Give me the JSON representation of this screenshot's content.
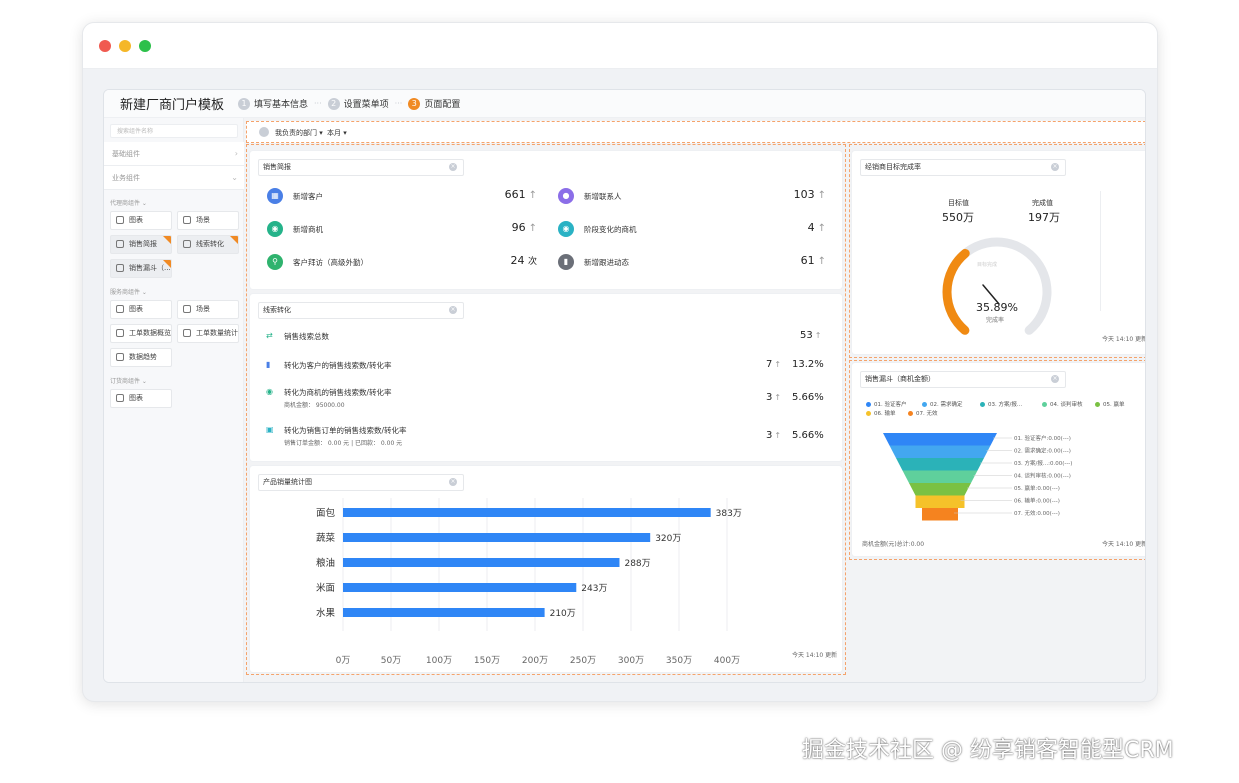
{
  "window": {
    "title_buttons": [
      {
        "name": "close",
        "color": "#f05a50"
      },
      {
        "name": "minimize",
        "color": "#f5b728"
      },
      {
        "name": "maximize",
        "color": "#2cc04a"
      }
    ]
  },
  "header": {
    "title": "新建厂商门户模板",
    "steps": [
      {
        "num": "1",
        "label": "填写基本信息"
      },
      {
        "num": "2",
        "label": "设置菜单项"
      },
      {
        "num": "3",
        "label": "页面配置"
      }
    ],
    "step_sep": "···"
  },
  "sidebar": {
    "search_placeholder": "搜索组件名称",
    "groups": [
      {
        "label": "基础组件",
        "chevron": "›"
      },
      {
        "label": "业务组件",
        "chevron": "⌄"
      }
    ],
    "sections": [
      {
        "label": "代理商组件 ⌄",
        "tiles": [
          "图表",
          "场景",
          "销售简报",
          "线索转化",
          "销售漏斗（..."
        ]
      },
      {
        "label": "服务商组件 ⌄",
        "tiles": [
          "图表",
          "场景",
          "工单数据概览",
          "工单数量统计",
          "数据趋势"
        ]
      },
      {
        "label": "订货商组件 ⌄",
        "tiles": [
          "图表"
        ]
      }
    ]
  },
  "filters": {
    "department": "我负责的部门 ▾",
    "period": "本月 ▾"
  },
  "sales_brief": {
    "title": "销售简报",
    "metrics": [
      {
        "label": "新增客户",
        "value": "661",
        "icon": "building-icon",
        "color": "#4a7fe6"
      },
      {
        "label": "新增联系人",
        "value": "103",
        "icon": "contact-icon",
        "color": "#8b6ee8"
      },
      {
        "label": "新增商机",
        "value": "96",
        "icon": "opportunity-icon",
        "color": "#25b38a"
      },
      {
        "label": "阶段变化的商机",
        "value": "4",
        "icon": "stage-icon",
        "color": "#2ab2c4"
      },
      {
        "label": "客户拜访（高级外勤）",
        "value": "24",
        "unit": "次",
        "icon": "visit-icon",
        "color": "#2fb36e"
      },
      {
        "label": "新增跟进动态",
        "value": "61",
        "icon": "activity-icon",
        "color": "#6b6f78"
      }
    ],
    "arrow": "↑"
  },
  "clue_conversion": {
    "title": "线索转化",
    "rows": [
      {
        "label": "销售线索总数",
        "count": "53",
        "pct": "",
        "sub": "",
        "icon": "⇄",
        "color": "#25b38a"
      },
      {
        "label": "转化为客户的销售线索数/转化率",
        "count": "7",
        "pct": "13.2%",
        "sub": "",
        "icon": "▮",
        "color": "#4a7fe6"
      },
      {
        "label": "转化为商机的销售线索数/转化率",
        "count": "3",
        "pct": "5.66%",
        "sub": "商机金额：  95000.00",
        "icon": "◉",
        "color": "#25b38a"
      },
      {
        "label": "转化为销售订单的销售线索数/转化率",
        "count": "3",
        "pct": "5.66%",
        "sub": "销售订单金额：  0.00 元  |  已回款：  0.00 元",
        "icon": "▣",
        "color": "#2ab2c4"
      }
    ]
  },
  "product_chart_card": {
    "title": "产品销量统计图",
    "footnote": "今天 14:10 更新"
  },
  "chart_data": {
    "type": "bar",
    "orientation": "horizontal",
    "categories": [
      "面包",
      "蔬菜",
      "粮油",
      "米面",
      "水果"
    ],
    "values": [
      383,
      320,
      288,
      243,
      210
    ],
    "value_labels": [
      "383万",
      "320万",
      "288万",
      "243万",
      "210万"
    ],
    "ticks": [
      "0万",
      "50万",
      "100万",
      "150万",
      "200万",
      "250万",
      "300万",
      "350万",
      "400万"
    ],
    "xlim": [
      0,
      400
    ],
    "color": "#2f86f6",
    "grid": true
  },
  "gauge_card": {
    "title": "经销商目标完成率",
    "target_label": "目标值",
    "target_value": "550万",
    "done_label": "完成值",
    "done_value": "197万",
    "percent": "35.89%",
    "percent_caption": "完成率",
    "inner_text": "目标完成",
    "fraction": 0.3589,
    "color": "#f08a12",
    "track_color": "#e4e6ea",
    "footnote": "今天 14:10 更新"
  },
  "funnel_card": {
    "title": "销售漏斗（商机金额）",
    "legend": [
      {
        "label": "01. 验证客户",
        "color": "#2f86f6"
      },
      {
        "label": "02. 需求确定",
        "color": "#43a7f0"
      },
      {
        "label": "03. 方案/报...",
        "color": "#2bb2b8"
      },
      {
        "label": "04. 谈判审核",
        "color": "#5fd09c"
      },
      {
        "label": "05. 赢单",
        "color": "#7ac143"
      },
      {
        "label": "06. 输单",
        "color": "#f5c22a"
      },
      {
        "label": "07. 无效",
        "color": "#f5831f"
      }
    ],
    "stage_labels": [
      "01. 验证客户:0.00(---)",
      "02. 需求确定:0.00(---)",
      "03. 方案/报...:0.00(---)",
      "04. 谈判审核:0.00(---)",
      "05. 赢单:0.00(---)",
      "06. 输单:0.00(---)",
      "07. 无效:0.00(---)"
    ],
    "total": "商机金额(元)总计:0.00",
    "footnote": "今天 14:10 更新"
  },
  "watermark": "掘金技术社区 @ 纷享销客智能型CRM"
}
